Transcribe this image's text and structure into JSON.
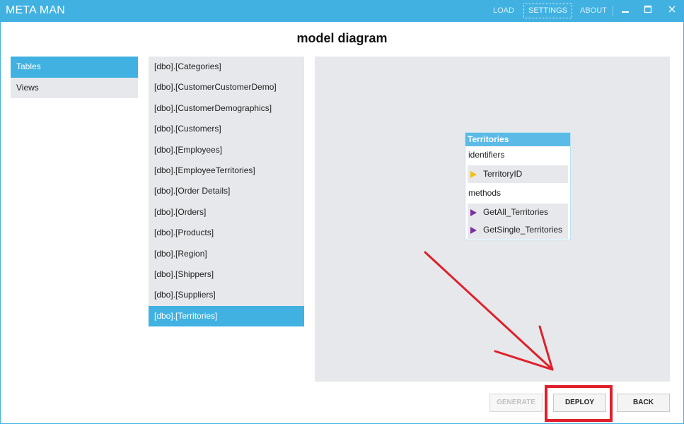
{
  "app": {
    "title": "META MAN",
    "nav": [
      "LOAD",
      "SETTINGS",
      "ABOUT"
    ],
    "active_nav": "SETTINGS",
    "controls": {
      "minimize": "—",
      "maximize": "□",
      "close": "✕"
    }
  },
  "page_title": "model diagram",
  "categories": {
    "items": [
      "Tables",
      "Views"
    ],
    "selected": "Tables"
  },
  "tables": {
    "items": [
      "[dbo].[Categories]",
      "[dbo].[CustomerCustomerDemo]",
      "[dbo].[CustomerDemographics]",
      "[dbo].[Customers]",
      "[dbo].[Employees]",
      "[dbo].[EmployeeTerritories]",
      "[dbo].[Order Details]",
      "[dbo].[Orders]",
      "[dbo].[Products]",
      "[dbo].[Region]",
      "[dbo].[Shippers]",
      "[dbo].[Suppliers]",
      "[dbo].[Territories]"
    ],
    "selected_index": 12
  },
  "entity": {
    "name": "Territories",
    "identifiers_label": "identifiers",
    "identifiers": [
      "TerritoryID"
    ],
    "methods_label": "methods",
    "methods": [
      "GetAll_Territories",
      "GetSingle_Territories"
    ]
  },
  "buttons": {
    "generate": "GENERATE",
    "deploy": "DEPLOY",
    "back": "BACK"
  },
  "colors": {
    "accent": "#41b1e1",
    "panel": "#e7e8eb",
    "annotation": "#e0202a",
    "identifier_marker": "#f3c01a",
    "method_marker": "#7b2fa0"
  }
}
